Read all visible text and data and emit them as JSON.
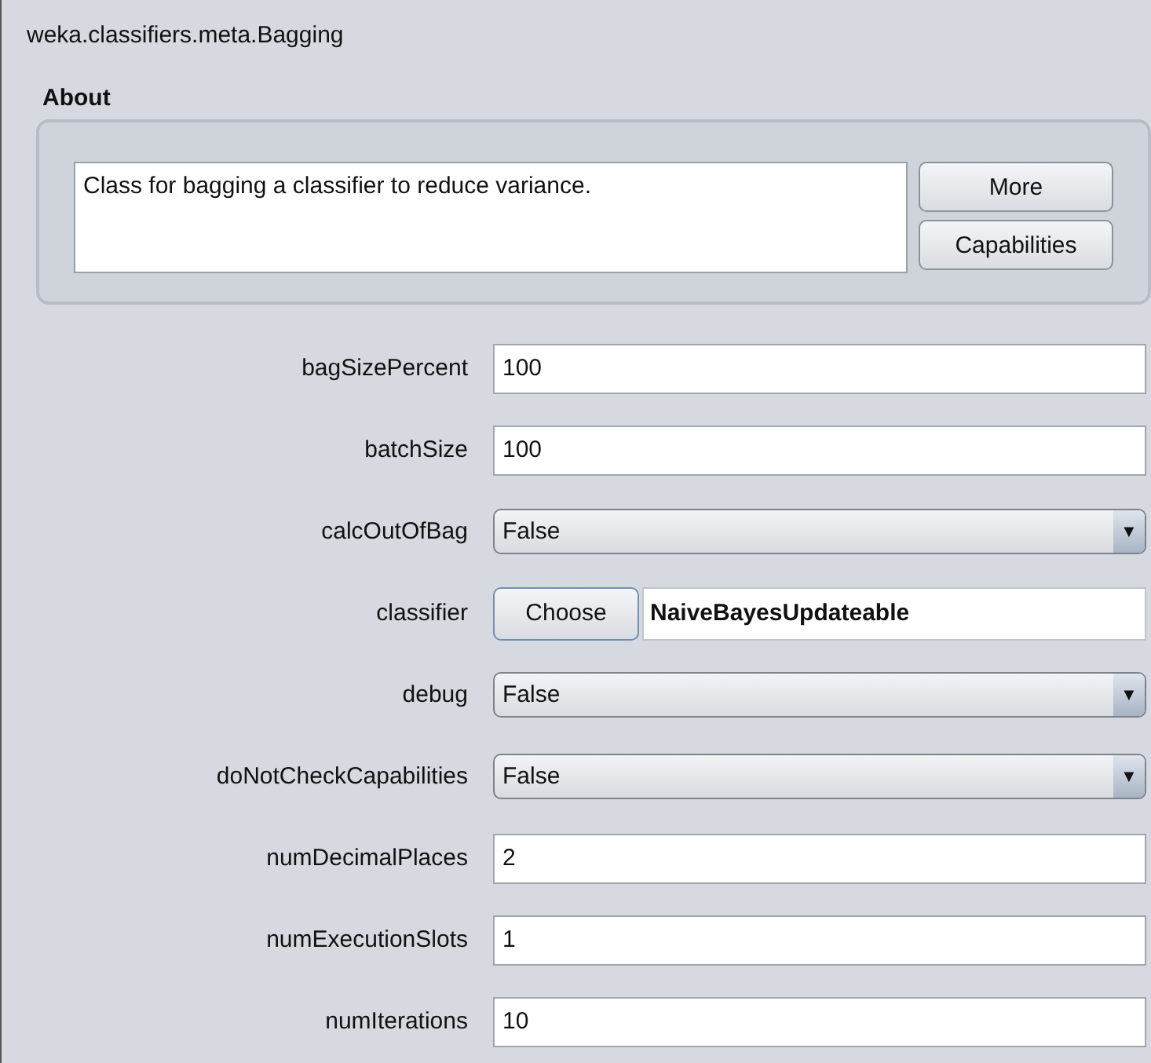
{
  "window": {
    "title": "weka.classifiers.meta.Bagging"
  },
  "about": {
    "heading": "About",
    "description": "Class for bagging a classifier to reduce variance.",
    "buttons": [
      "More",
      "Capabilities"
    ]
  },
  "properties": [
    {
      "kind": "text",
      "label": "bagSizePercent",
      "value": "100"
    },
    {
      "kind": "text",
      "label": "batchSize",
      "value": "100"
    },
    {
      "kind": "combo",
      "label": "calcOutOfBag",
      "value": "False",
      "arrow": "▼"
    },
    {
      "kind": "chooser",
      "label": "classifier",
      "button": "Choose",
      "value": "NaiveBayesUpdateable"
    },
    {
      "kind": "combo",
      "label": "debug",
      "value": "False",
      "arrow": "▼"
    },
    {
      "kind": "combo",
      "label": "doNotCheckCapabilities",
      "value": "False",
      "arrow": "▼"
    },
    {
      "kind": "text",
      "label": "numDecimalPlaces",
      "value": "2"
    },
    {
      "kind": "text",
      "label": "numExecutionSlots",
      "value": "1"
    },
    {
      "kind": "text",
      "label": "numIterations",
      "value": "10"
    }
  ]
}
